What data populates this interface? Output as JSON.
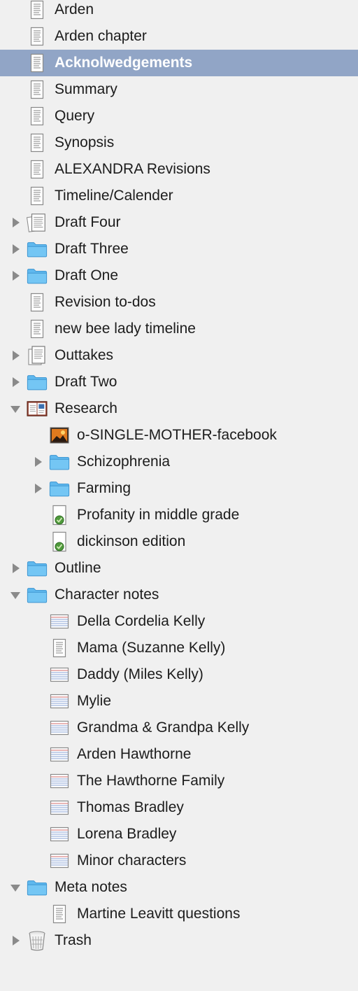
{
  "binder": {
    "rows": [
      {
        "label": "Arden",
        "icon": "text-document-icon",
        "depth": 0,
        "disclosure": "none"
      },
      {
        "label": "Arden chapter",
        "icon": "text-document-icon",
        "depth": 0,
        "disclosure": "none"
      },
      {
        "label": "Acknolwedgements",
        "icon": "text-document-icon",
        "depth": 0,
        "disclosure": "none",
        "selected": true
      },
      {
        "label": "Summary",
        "icon": "text-document-icon",
        "depth": 0,
        "disclosure": "none"
      },
      {
        "label": "Query",
        "icon": "text-document-icon",
        "depth": 0,
        "disclosure": "none"
      },
      {
        "label": "Synopsis",
        "icon": "text-document-icon",
        "depth": 0,
        "disclosure": "none"
      },
      {
        "label": "ALEXANDRA Revisions",
        "icon": "text-document-icon",
        "depth": 0,
        "disclosure": "none"
      },
      {
        "label": "Timeline/Calender",
        "icon": "text-document-icon",
        "depth": 0,
        "disclosure": "none"
      },
      {
        "label": "Draft Four",
        "icon": "draft-stack-icon",
        "depth": 0,
        "disclosure": "collapsed"
      },
      {
        "label": "Draft Three",
        "icon": "folder-icon",
        "depth": 0,
        "disclosure": "collapsed"
      },
      {
        "label": "Draft One",
        "icon": "folder-icon",
        "depth": 0,
        "disclosure": "collapsed"
      },
      {
        "label": "Revision to-dos",
        "icon": "text-document-icon",
        "depth": 0,
        "disclosure": "none"
      },
      {
        "label": "new bee lady timeline",
        "icon": "text-document-icon",
        "depth": 0,
        "disclosure": "none"
      },
      {
        "label": "Outtakes",
        "icon": "document-stack-icon",
        "depth": 0,
        "disclosure": "collapsed"
      },
      {
        "label": "Draft Two",
        "icon": "folder-icon",
        "depth": 0,
        "disclosure": "collapsed"
      },
      {
        "label": "Research",
        "icon": "research-book-icon",
        "depth": 0,
        "disclosure": "expanded"
      },
      {
        "label": "o-SINGLE-MOTHER-facebook",
        "icon": "image-icon",
        "depth": 1,
        "disclosure": "none"
      },
      {
        "label": "Schizophrenia",
        "icon": "folder-icon",
        "depth": 1,
        "disclosure": "collapsed"
      },
      {
        "label": "Farming",
        "icon": "folder-icon",
        "depth": 1,
        "disclosure": "collapsed"
      },
      {
        "label": "Profanity in middle grade",
        "icon": "web-document-icon",
        "depth": 1,
        "disclosure": "none"
      },
      {
        "label": "dickinson edition",
        "icon": "web-document-icon",
        "depth": 1,
        "disclosure": "none"
      },
      {
        "label": "Outline",
        "icon": "folder-icon",
        "depth": 0,
        "disclosure": "collapsed"
      },
      {
        "label": "Character notes",
        "icon": "folder-icon",
        "depth": 0,
        "disclosure": "expanded"
      },
      {
        "label": "Della Cordelia Kelly",
        "icon": "character-sheet-icon",
        "depth": 1,
        "disclosure": "none"
      },
      {
        "label": "Mama (Suzanne Kelly)",
        "icon": "text-document-icon",
        "depth": 1,
        "disclosure": "none"
      },
      {
        "label": "Daddy (Miles Kelly)",
        "icon": "character-sheet-icon",
        "depth": 1,
        "disclosure": "none"
      },
      {
        "label": "Mylie",
        "icon": "character-sheet-icon",
        "depth": 1,
        "disclosure": "none"
      },
      {
        "label": "Grandma & Grandpa Kelly",
        "icon": "character-sheet-icon",
        "depth": 1,
        "disclosure": "none"
      },
      {
        "label": "Arden Hawthorne",
        "icon": "character-sheet-icon",
        "depth": 1,
        "disclosure": "none"
      },
      {
        "label": "The Hawthorne Family",
        "icon": "character-sheet-icon",
        "depth": 1,
        "disclosure": "none"
      },
      {
        "label": "Thomas Bradley",
        "icon": "character-sheet-icon",
        "depth": 1,
        "disclosure": "none"
      },
      {
        "label": "Lorena Bradley",
        "icon": "character-sheet-icon",
        "depth": 1,
        "disclosure": "none"
      },
      {
        "label": "Minor characters",
        "icon": "character-sheet-icon",
        "depth": 1,
        "disclosure": "none"
      },
      {
        "label": "Meta notes",
        "icon": "folder-icon",
        "depth": 0,
        "disclosure": "expanded"
      },
      {
        "label": "Martine Leavitt questions",
        "icon": "text-document-icon",
        "depth": 1,
        "disclosure": "none"
      },
      {
        "label": "Trash",
        "icon": "trash-icon",
        "depth": 0,
        "disclosure": "collapsed"
      }
    ]
  },
  "colors": {
    "background": "#f0f0f0",
    "selection": "#91a5c6",
    "folder": "#5fb8ee",
    "text": "#1c1c1c"
  }
}
